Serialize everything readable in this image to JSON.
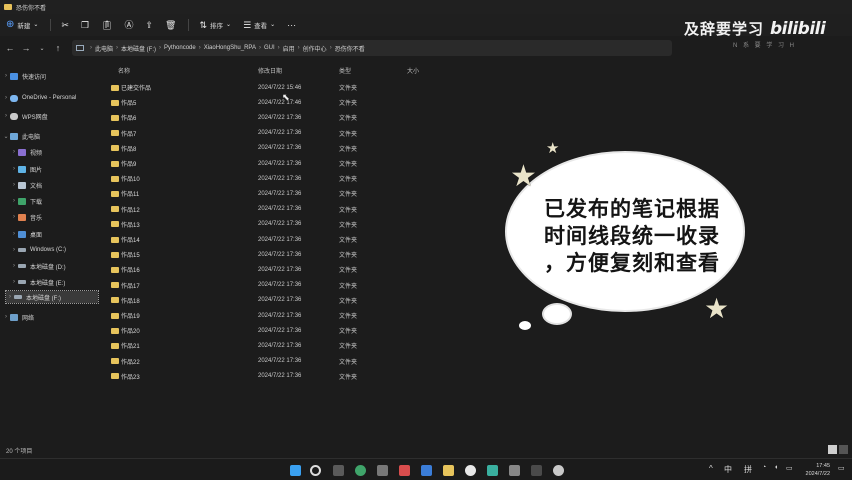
{
  "window": {
    "title": "恐伤你不看"
  },
  "command_bar": {
    "new_label": "新建",
    "sort_label": "排序",
    "view_label": "查看",
    "more_label": "···"
  },
  "breadcrumb": [
    "此电脑",
    "本地磁盘 (F:)",
    "Pythoncode",
    "XiaoHongShu_RPA",
    "GUI",
    "启用",
    "创作中心",
    "恐伤你不看"
  ],
  "watermark": {
    "text": "及辞要学习",
    "logo": "bilibili",
    "sub": "N  系 要 学 习 H"
  },
  "sidebar": {
    "items": [
      {
        "label": "快速访问",
        "icon": "star-icon"
      },
      {
        "label": "OneDrive - Personal",
        "icon": "cloud-icon"
      },
      {
        "label": "WPS网盘",
        "icon": "cloud-icon"
      },
      {
        "label": "此电脑",
        "icon": "pc-icon"
      },
      {
        "label": "视频",
        "icon": "video-icon"
      },
      {
        "label": "图片",
        "icon": "picture-icon"
      },
      {
        "label": "文档",
        "icon": "document-icon"
      },
      {
        "label": "下载",
        "icon": "download-icon"
      },
      {
        "label": "音乐",
        "icon": "music-icon"
      },
      {
        "label": "桌面",
        "icon": "desktop-icon"
      },
      {
        "label": "Windows (C:)",
        "icon": "drive-icon"
      },
      {
        "label": "本地磁盘 (D:)",
        "icon": "drive-icon"
      },
      {
        "label": "本地磁盘 (E:)",
        "icon": "drive-icon"
      },
      {
        "label": "本地磁盘 (F:)",
        "icon": "drive-icon"
      },
      {
        "label": "网络",
        "icon": "network-icon"
      }
    ]
  },
  "columns": {
    "name": "名称",
    "date": "修改日期",
    "type": "类型",
    "size": "大小"
  },
  "files": [
    {
      "name": "已建交作品",
      "date": "2024/7/22 15:46",
      "type": "文件夹"
    },
    {
      "name": "作品5",
      "date": "2024/7/22 17:46",
      "type": "文件夹"
    },
    {
      "name": "作品6",
      "date": "2024/7/22 17:36",
      "type": "文件夹"
    },
    {
      "name": "作品7",
      "date": "2024/7/22 17:36",
      "type": "文件夹"
    },
    {
      "name": "作品8",
      "date": "2024/7/22 17:36",
      "type": "文件夹"
    },
    {
      "name": "作品9",
      "date": "2024/7/22 17:36",
      "type": "文件夹"
    },
    {
      "name": "作品10",
      "date": "2024/7/22 17:36",
      "type": "文件夹"
    },
    {
      "name": "作品11",
      "date": "2024/7/22 17:36",
      "type": "文件夹"
    },
    {
      "name": "作品12",
      "date": "2024/7/22 17:36",
      "type": "文件夹"
    },
    {
      "name": "作品13",
      "date": "2024/7/22 17:36",
      "type": "文件夹"
    },
    {
      "name": "作品14",
      "date": "2024/7/22 17:36",
      "type": "文件夹"
    },
    {
      "name": "作品15",
      "date": "2024/7/22 17:36",
      "type": "文件夹"
    },
    {
      "name": "作品16",
      "date": "2024/7/22 17:36",
      "type": "文件夹"
    },
    {
      "name": "作品17",
      "date": "2024/7/22 17:36",
      "type": "文件夹"
    },
    {
      "name": "作品18",
      "date": "2024/7/22 17:36",
      "type": "文件夹"
    },
    {
      "name": "作品19",
      "date": "2024/7/22 17:36",
      "type": "文件夹"
    },
    {
      "name": "作品20",
      "date": "2024/7/22 17:36",
      "type": "文件夹"
    },
    {
      "name": "作品21",
      "date": "2024/7/22 17:36",
      "type": "文件夹"
    },
    {
      "name": "作品22",
      "date": "2024/7/22 17:36",
      "type": "文件夹"
    },
    {
      "name": "作品23",
      "date": "2024/7/22 17:36",
      "type": "文件夹"
    }
  ],
  "status": {
    "count": "20 个项目"
  },
  "overlay": {
    "lines": [
      "已发布的笔记根据",
      "时间线段统一收录",
      "，方便复刻和查看"
    ]
  },
  "taskbar": {
    "ime_label": "中",
    "ime_mode": "拼",
    "time": "17:45",
    "date": "2024/7/22"
  },
  "colors": {
    "folder": "#e7c45c",
    "accent": "#5aa0ff",
    "background": "#1c1c1c"
  }
}
